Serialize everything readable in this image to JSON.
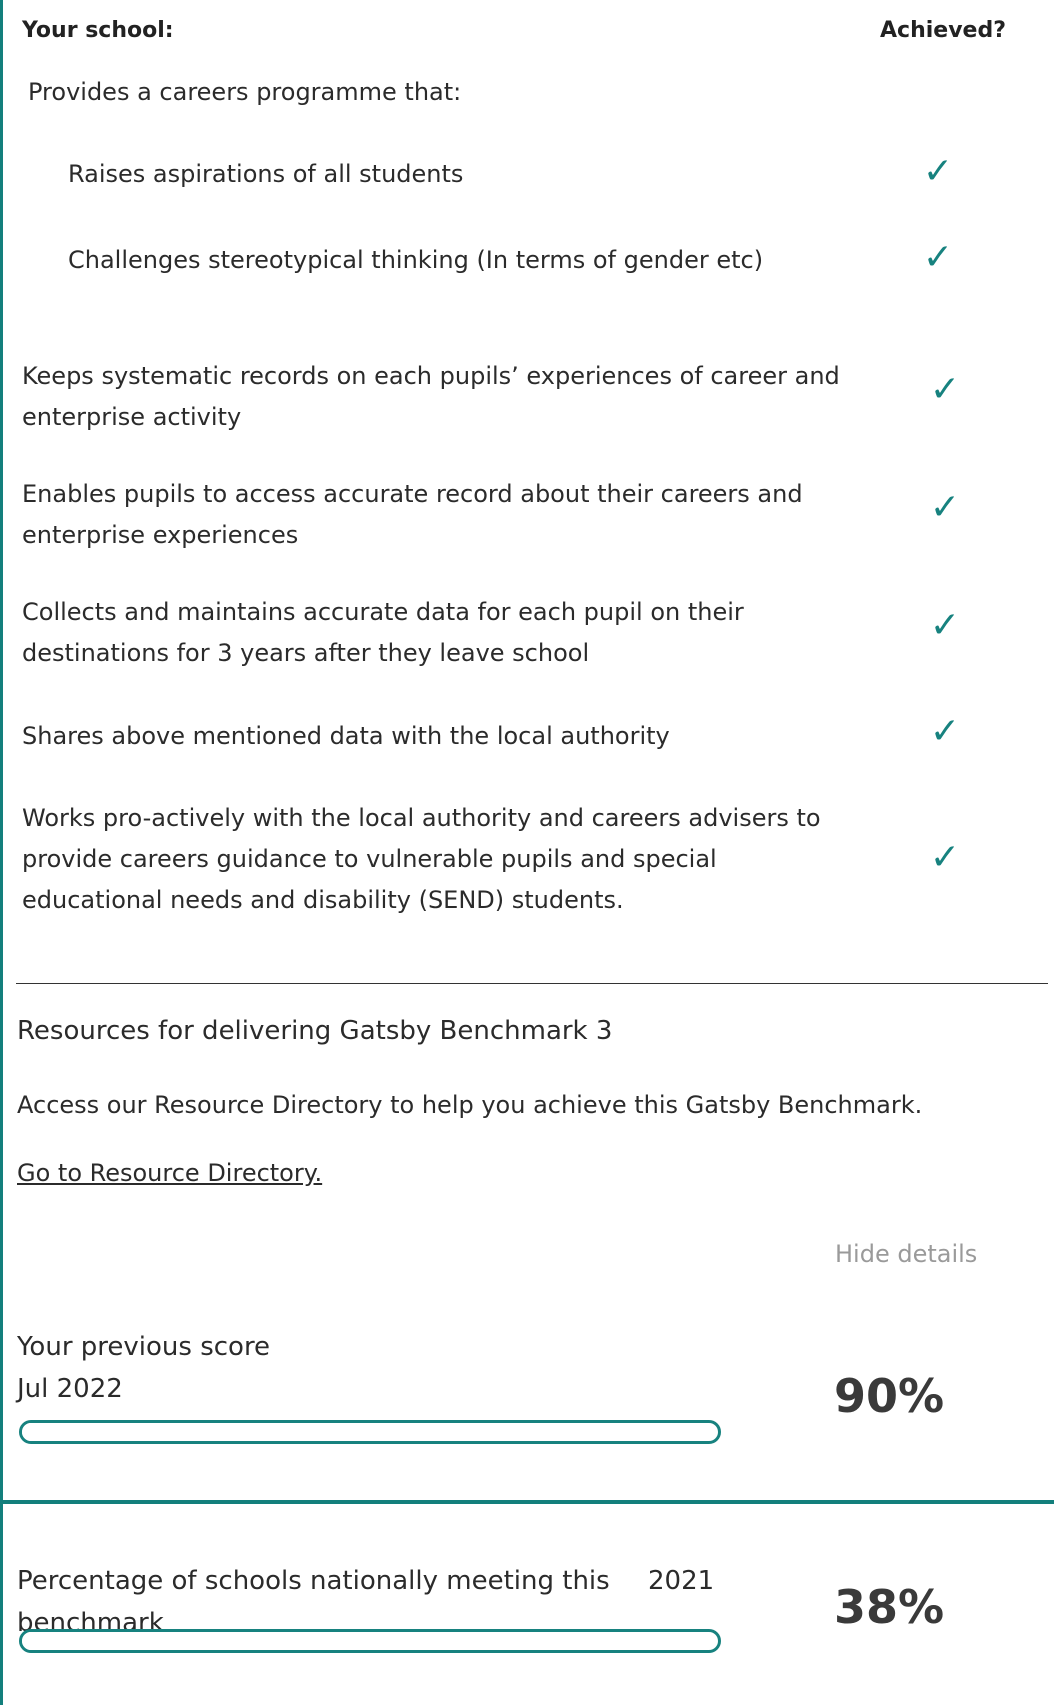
{
  "header": {
    "your_school": "Your school:",
    "achieved": "Achieved?"
  },
  "intro": "Provides a careers programme that:",
  "criteria": [
    {
      "text": "Raises aspirations of all students",
      "achieved": true
    },
    {
      "text": "Challenges stereotypical thinking (In terms of gender etc)",
      "achieved": true
    },
    {
      "text": "Keeps systematic records on each pupils’ experiences of career and enterprise activity",
      "achieved": true
    },
    {
      "text": "Enables pupils to access accurate record about their careers and enterprise experiences",
      "achieved": true
    },
    {
      "text": "Collects and maintains accurate data for each pupil on their destinations for 3 years after they leave school",
      "achieved": true
    },
    {
      "text": "Shares above mentioned data with the local authority",
      "achieved": true
    },
    {
      "text": "Works pro-actively with the local authority and careers advisers to provide careers guidance to vulnerable pupils and special educational needs and disability (SEND) students.",
      "achieved": true
    }
  ],
  "check_glyph": "✓",
  "resources": {
    "title": "Resources for delivering Gatsby Benchmark 3",
    "description": "Access our Resource Directory to help you achieve this Gatsby Benchmark.",
    "link": "Go to Resource Directory."
  },
  "toggle": {
    "label": "Hide details"
  },
  "previous_score": {
    "label": "Your previous score",
    "date": "Jul 2022",
    "value": "90%",
    "fraction": 0.9
  },
  "national": {
    "label": "Percentage of schools nationally meeting this benchmark",
    "year": "2021",
    "value": "38%",
    "fraction": 0.38
  },
  "colors": {
    "accent": "#17827f",
    "frame": "#137f7c",
    "muted": "#9a9a9a"
  }
}
